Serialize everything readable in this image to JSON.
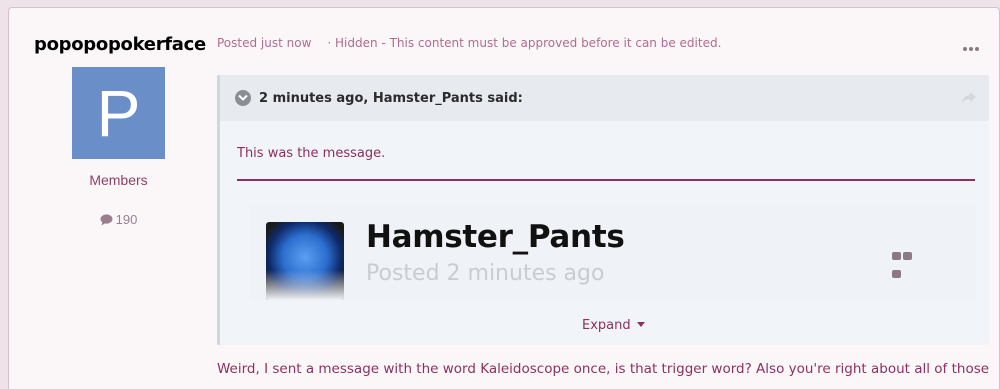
{
  "author": {
    "name": "popopopokerface",
    "avatar_letter": "P",
    "group": "Members",
    "post_count": "190"
  },
  "post_meta": {
    "posted": "Posted just now",
    "hidden_notice": "· Hidden - This content must be approved before it can be edited."
  },
  "quote": {
    "citation": "2 minutes ago, Hamster_Pants said:",
    "message": "This was the message.",
    "embed": {
      "name": "Hamster_Pants",
      "time": "Posted 2 minutes ago"
    },
    "expand_label": "Expand"
  },
  "post_body": "Weird, I sent a message with the word Kaleidoscope once, is that trigger word? Also you're right about all of those",
  "colors": {
    "accent": "#8e2f5e",
    "avatar_bg": "#6a8ec8",
    "page_bg": "#efe3ea",
    "post_bg": "#fbf7f9"
  },
  "icons": {
    "post_count": "speech-bubble-icon",
    "quote_toggle": "chevron-down-icon",
    "quote_share": "share-icon",
    "menu": "ellipsis-icon",
    "expand_caret": "caret-down-icon"
  }
}
